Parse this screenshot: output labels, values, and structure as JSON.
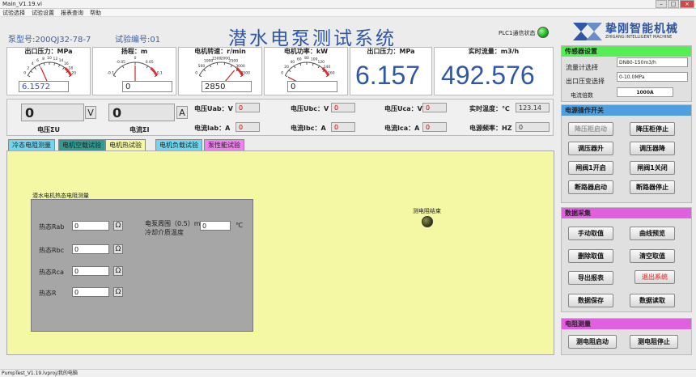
{
  "window": {
    "title": "Main_V1.19.vi"
  },
  "menu": [
    "试验选择",
    "试验设置",
    "报表查询",
    "帮助"
  ],
  "header": {
    "pump_model": "泵型号:200QJ32-78-7",
    "test_no": "试验编号:01",
    "title": "潜水电泵测试系统",
    "plc_status": "PLC1通信状态",
    "logo_cn": "挚刚智能机械",
    "logo_en": "ZHIGANG INTELLIGENT MACHINE"
  },
  "gauges": [
    {
      "title": "出口压力：MPa",
      "value": "6.1572",
      "ticks": [
        "0",
        "2",
        "4",
        "6",
        "8",
        "10",
        "12",
        "14",
        "16",
        "18",
        "20"
      ],
      "min": 0,
      "max": 20,
      "reading": 6.1572
    },
    {
      "title": "扬程：m",
      "value": "0",
      "ticks": [
        "-0.1",
        "-0.05",
        "0",
        "0.05",
        "0.1"
      ],
      "min": -0.1,
      "max": 0.1,
      "reading": 0
    },
    {
      "title": "电机转速：r/min",
      "value": "2850",
      "ticks": [
        "0",
        "500",
        "1000",
        "1500",
        "2000",
        "2500",
        "3000",
        "3500"
      ],
      "min": 0,
      "max": 3500,
      "reading": 2850
    },
    {
      "title": "电机功率：kW",
      "value": "0",
      "ticks": [
        "0",
        "20",
        "40",
        "60",
        "80",
        "100",
        "120",
        "140",
        "160"
      ],
      "min": 0,
      "max": 160,
      "reading": 0
    }
  ],
  "digital": [
    {
      "title": "出口压力：MPa",
      "value": "6.157"
    },
    {
      "title": "实时流量：m3/h",
      "value": "492.576"
    }
  ],
  "electric": {
    "voltage": {
      "value": "0",
      "unit": "V",
      "label": "电压ΣU"
    },
    "current": {
      "value": "0",
      "unit": "A",
      "label": "电流ΣI"
    },
    "cells": [
      {
        "label": "电压Uab：V",
        "value": "0"
      },
      {
        "label": "电压Ubc：V",
        "value": "0"
      },
      {
        "label": "电压Uca：V",
        "value": "0"
      },
      {
        "label": "电流Iab：A",
        "value": "0"
      },
      {
        "label": "电流Ibc：A",
        "value": "0"
      },
      {
        "label": "电流Ica：A",
        "value": "0"
      }
    ],
    "temp": {
      "label": "实时温度：℃",
      "value": "123.14"
    },
    "freq": {
      "label": "电源频率：HZ",
      "value": "0"
    }
  },
  "tabs": [
    {
      "label": "冷态电阻测量",
      "color": "#6fd6f0"
    },
    {
      "label": "电机空载试验",
      "color": "#2f9c93"
    },
    {
      "label": "电机热试验",
      "color": "#f4f8a4"
    },
    {
      "label": "电机负载试验",
      "color": "#6fd6f0"
    },
    {
      "label": "泵性能试验",
      "color": "#ee82ee"
    }
  ],
  "hot_test": {
    "panel_title": "潜水电机热态电阻测量",
    "rows": [
      {
        "label": "热态Rab",
        "value": "0"
      },
      {
        "label": "热态Rbc",
        "value": "0"
      },
      {
        "label": "热态Rca",
        "value": "0"
      },
      {
        "label": "热态R",
        "value": "0"
      }
    ],
    "omega": "Ω",
    "temp_label_1": "电泵周围（0.5）m",
    "temp_label_2": "冷却介质温度",
    "temp_value": "0",
    "temp_unit": "℃",
    "led_label": "测电阻结束"
  },
  "sidebar": {
    "sensor": {
      "title": "传感器设置",
      "rows": [
        {
          "label": "流量计选择",
          "value": "DN80-150m3/h"
        },
        {
          "label": "出口压变选择",
          "value": "0-10.0MPa"
        },
        {
          "label": "电流倍数",
          "value": "1000A"
        }
      ]
    },
    "power": {
      "title": "电源操作开关",
      "buttons": [
        "降压柜启动",
        "降压柜停止",
        "调压器升",
        "调压器降",
        "闸阀1开启",
        "闸阀1关闭",
        "断路器启动",
        "断路器停止"
      ]
    },
    "data": {
      "title": "数据采集",
      "buttons": [
        "手动取值",
        "曲线预览",
        "删除取值",
        "清空取值",
        "导出报表",
        "退出系统",
        "数据保存",
        "数据读取"
      ]
    },
    "resist": {
      "title": "电阻测量",
      "buttons": [
        "测电阻启动",
        "测电阻停止"
      ]
    }
  },
  "status": "PumpTest_V1.19.lvproj/我的电脑"
}
